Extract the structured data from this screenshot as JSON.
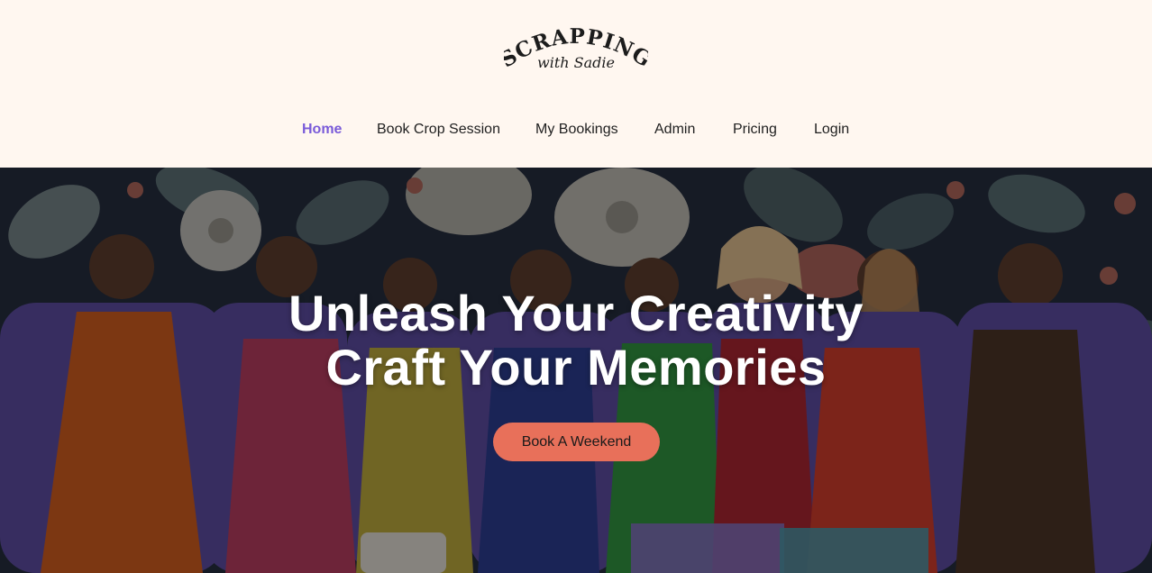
{
  "brand": {
    "line1": "SCRAPPING",
    "line2": "with Sadie"
  },
  "nav": {
    "items": [
      {
        "label": "Home",
        "active": true
      },
      {
        "label": "Book Crop Session",
        "active": false
      },
      {
        "label": "My Bookings",
        "active": false
      },
      {
        "label": "Admin",
        "active": false
      },
      {
        "label": "Pricing",
        "active": false
      },
      {
        "label": "Login",
        "active": false
      }
    ]
  },
  "hero": {
    "headline_line1": "Unleash Your Creativity",
    "headline_line2": "Craft Your Memories",
    "cta_label": "Book A Weekend"
  },
  "colors": {
    "background": "#fff7f0",
    "nav_active": "#7a5bd9",
    "cta": "#e8705a"
  }
}
